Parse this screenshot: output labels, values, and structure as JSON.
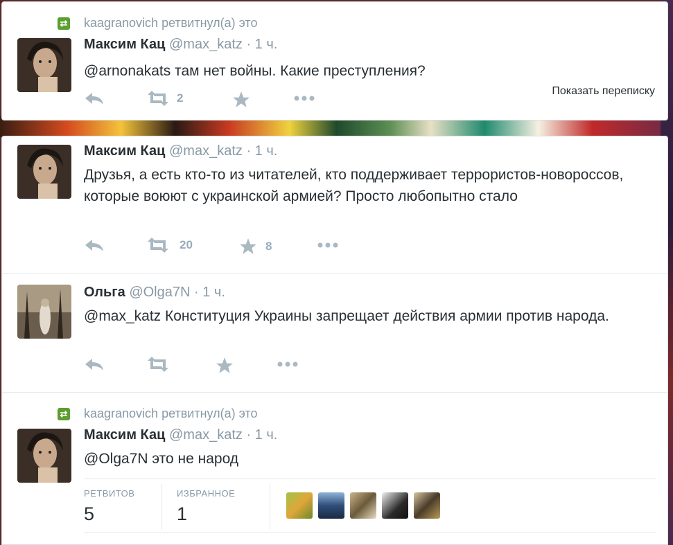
{
  "tweets": [
    {
      "retweet_context": "kaagranovich ретвитнул(а) это",
      "name": "Максим Кац",
      "handle": "@max_katz",
      "dot": "·",
      "time": "1 ч.",
      "text": "@arnonakats там нет войны. Какие преступления?",
      "retweets": "2",
      "favorites": "",
      "show_conversation": "Показать переписку"
    },
    {
      "name": "Максим Кац",
      "handle": "@max_katz",
      "dot": "·",
      "time": "1 ч.",
      "text": "Друзья, а есть кто-то из читателей, кто поддерживает террористов-новороссов, которые воюют с украинской армией? Просто любопытно стало",
      "retweets": "20",
      "favorites": "8"
    },
    {
      "name": "Ольга",
      "handle": "@Olga7N",
      "dot": "·",
      "time": "1 ч.",
      "text": "@max_katz Конституция Украины запрещает действия армии против народа.",
      "retweets": "",
      "favorites": ""
    },
    {
      "retweet_context": "kaagranovich ретвитнул(а) это",
      "name": "Максим Кац",
      "handle": "@max_katz",
      "dot": "·",
      "time": "1 ч.",
      "text": "@Olga7N это не народ",
      "stats": {
        "retweets_label": "РЕТВИТОВ",
        "retweets_value": "5",
        "favorites_label": "ИЗБРАННОЕ",
        "favorites_value": "1"
      }
    }
  ],
  "icons": {
    "reply": "reply-icon",
    "retweet": "retweet-icon",
    "favorite": "star-icon",
    "more": "more-icon",
    "retweet_context": "retweet-badge-icon"
  },
  "colors": {
    "retweet_badge": "#5c9e2f",
    "secondary_text": "#8899a6",
    "primary_text": "#292f33"
  }
}
